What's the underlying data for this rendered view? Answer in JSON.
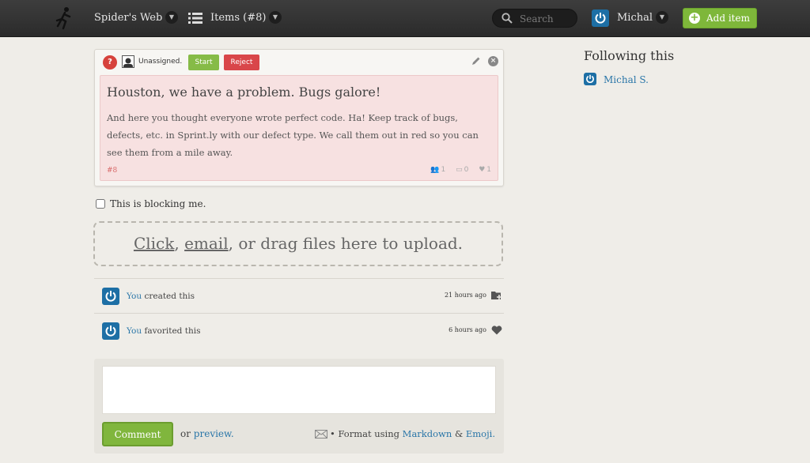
{
  "header": {
    "project_name": "Spider's Web",
    "items_label": "Items (#8)",
    "search_placeholder": "Search",
    "user_name": "Michal",
    "add_item_label": "Add item"
  },
  "card": {
    "status_icon": "?",
    "assignee": "Unassigned.",
    "start_label": "Start",
    "reject_label": "Reject",
    "title": "Houston, we have a problem. Bugs galore!",
    "description": "And here you thought everyone wrote perfect code. Ha! Keep track of bugs, defects, etc. in Sprint.ly with our defect type. We call them out in red so you can see them from a mile away.",
    "number": "#8",
    "followers_count": "1",
    "comments_count": "0",
    "favorites_count": "1",
    "colors": {
      "defect_bg": "#f7e1e1",
      "start": "#86bb47",
      "reject": "#d9464a"
    }
  },
  "blocking": {
    "label": "This is blocking me.",
    "checked": false
  },
  "upload": {
    "click": "Click",
    "sep1": ", ",
    "email": "email",
    "rest": ", or drag files here to upload."
  },
  "activity": [
    {
      "actor": "You",
      "action": "created this",
      "time": "21 hours ago",
      "icon": "folder-add-icon"
    },
    {
      "actor": "You",
      "action": "favorited this",
      "time": "6 hours ago",
      "icon": "heart-icon"
    }
  ],
  "comment": {
    "button_label": "Comment",
    "or_text": "or",
    "preview_label": "preview.",
    "format_text": "• Format using",
    "markdown_label": "Markdown",
    "amp": "&",
    "emoji_label": "Emoji."
  },
  "sidebar": {
    "following_title": "Following this",
    "followers": [
      {
        "name": "Michal S."
      }
    ]
  },
  "colors": {
    "accent": "#7eb73a",
    "link": "#2a76a8",
    "topbar": "#333333"
  }
}
